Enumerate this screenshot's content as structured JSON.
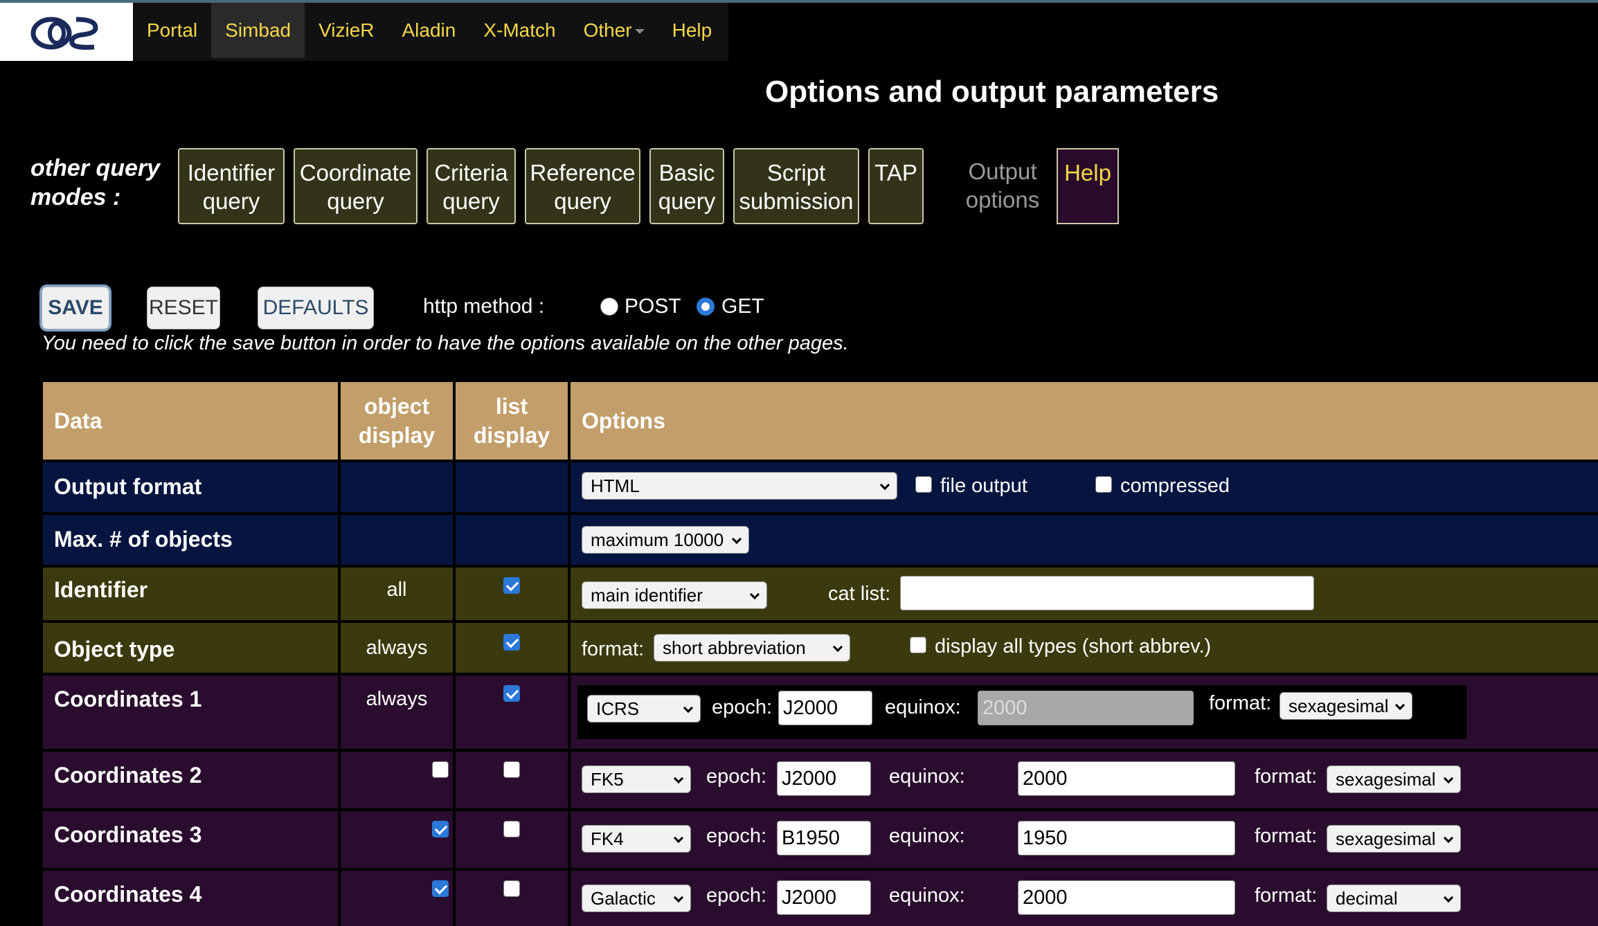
{
  "nav": {
    "logo_text": "CDS",
    "items": [
      "Portal",
      "Simbad",
      "VizieR",
      "Aladin",
      "X-Match",
      "Other",
      "Help"
    ]
  },
  "page_title": "Options and output parameters",
  "query_modes": {
    "label_line1": "other query",
    "label_line2": "modes :",
    "buttons": [
      {
        "line1": "Identifier",
        "line2": "query"
      },
      {
        "line1": "Coordinate",
        "line2": "query"
      },
      {
        "line1": "Criteria",
        "line2": "query"
      },
      {
        "line1": "Reference",
        "line2": "query"
      },
      {
        "line1": "Basic",
        "line2": "query"
      },
      {
        "line1": "Script",
        "line2": "submission"
      },
      {
        "line1": "TAP",
        "line2": ""
      }
    ],
    "output_line1": "Output",
    "output_line2": "options",
    "help": "Help"
  },
  "actions": {
    "save": "SAVE",
    "reset": "RESET",
    "defaults": "DEFAULTS",
    "http_label": "http method :",
    "post": "POST",
    "get": "GET",
    "selected_method": "GET",
    "note": "You need to click the save button in order to have the options available on the other pages."
  },
  "table": {
    "headers": {
      "data": "Data",
      "object_line1": "object",
      "object_line2": "display",
      "list_line1": "list",
      "list_line2": "display",
      "options": "Options"
    },
    "output_format": {
      "name": "Output format",
      "format_value": "HTML",
      "file_output": "file output",
      "compressed": "compressed"
    },
    "max_objects": {
      "name": "Max. # of objects",
      "value": "maximum 10000"
    },
    "identifier": {
      "name": "Identifier",
      "object_display": "all",
      "list_checked": true,
      "select_value": "main identifier",
      "cat_list_label": "cat list:",
      "cat_list_value": ""
    },
    "object_type": {
      "name": "Object type",
      "object_display": "always",
      "list_checked": true,
      "format_label": "format:",
      "format_value": "short abbreviation",
      "all_types_label": "display all types (short abbrev.)"
    },
    "coords": [
      {
        "name": "Coordinates 1",
        "object_display": "always",
        "object_checked": null,
        "list_checked": true,
        "frame": "ICRS",
        "epoch": "J2000",
        "equinox": "2000",
        "equinox_disabled": true,
        "format": "sexagesimal"
      },
      {
        "name": "Coordinates 2",
        "object_display": "",
        "object_checked": false,
        "list_checked": false,
        "frame": "FK5",
        "epoch": "J2000",
        "equinox": "2000",
        "equinox_disabled": false,
        "format": "sexagesimal"
      },
      {
        "name": "Coordinates 3",
        "object_display": "",
        "object_checked": true,
        "list_checked": false,
        "frame": "FK4",
        "epoch": "B1950",
        "equinox": "1950",
        "equinox_disabled": false,
        "format": "sexagesimal"
      },
      {
        "name": "Coordinates 4",
        "object_display": "",
        "object_checked": true,
        "list_checked": false,
        "frame": "Galactic",
        "epoch": "J2000",
        "equinox": "2000",
        "equinox_disabled": false,
        "format": "decimal"
      }
    ],
    "epoch_label": "epoch:",
    "equinox_label": "equinox:",
    "format_label": "format:"
  },
  "colors": {
    "accent_yellow": "#f5d74a",
    "header_tan": "#c29e6a",
    "navy_row": "#061540",
    "olive_row": "#3a3a0e",
    "plum_row": "#2a0d2e",
    "checkbox_blue": "#2b78d8"
  }
}
